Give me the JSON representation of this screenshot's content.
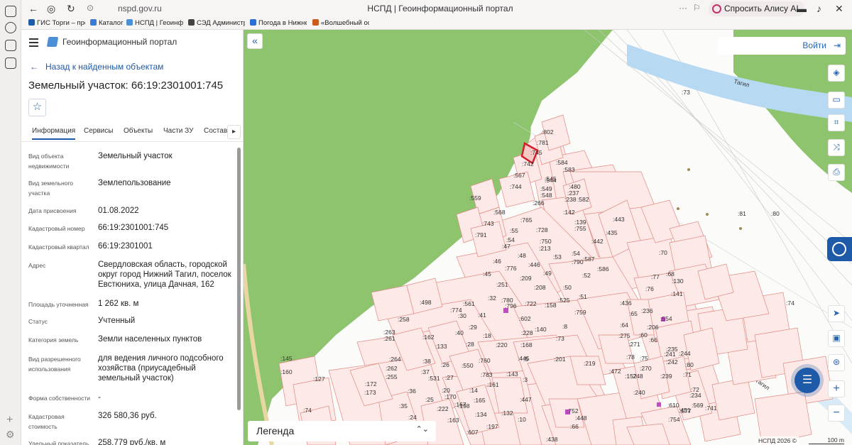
{
  "browser": {
    "url": "nspd.gov.ru",
    "page_title": "НСПД | Геоинформационный портал",
    "alice_label": "Спросить Алису AI"
  },
  "bookmarks": [
    {
      "label": "ГИС Торги – прод",
      "color": "#1d5aa8"
    },
    {
      "label": "Каталог",
      "color": "#3a7bd5"
    },
    {
      "label": "НСПД | Геоинфор",
      "color": "#4d8fd6"
    },
    {
      "label": "СЭД Администрат",
      "color": "#444444"
    },
    {
      "label": "Погода в Нижнем",
      "color": "#2c6ed3"
    },
    {
      "label": "«Волшебный ост",
      "color": "#cc5a1a"
    }
  ],
  "panel": {
    "portal_title": "Геоинформационный портал",
    "back_label": "Назад к найденным объектам",
    "parcel_title": "Земельный участок: 66:19:2301001:745",
    "tabs": [
      "Информация",
      "Сервисы",
      "Объекты",
      "Части ЗУ",
      "Состав"
    ],
    "fields": [
      {
        "label": "Вид объекта недвижимости",
        "value": "Земельный участок"
      },
      {
        "label": "Вид земельного участка",
        "value": "Землепользование"
      },
      {
        "label": "Дата присвоения",
        "value": "01.08.2022"
      },
      {
        "label": "Кадастровый номер",
        "value": "66:19:2301001:745"
      },
      {
        "label": "Кадастровый квартал",
        "value": "66:19:2301001"
      },
      {
        "label": "Адрес",
        "value": "Свердловская область, городской округ город Нижний Тагил, поселок Евстюниха, улица Дачная, 162"
      },
      {
        "label": "Площадь уточненная",
        "value": "1 262 кв. м"
      },
      {
        "label": "Статус",
        "value": "Учтенный"
      },
      {
        "label": "Категория земель",
        "value": "Земли населенных пунктов"
      },
      {
        "label": "Вид разрешенного использования",
        "value": "для ведения личного подсобного хозяйства (приусадебный земельный участок)"
      },
      {
        "label": "Форма собственности",
        "value": "-"
      },
      {
        "label": "Кадастровая стоимость",
        "value": "326 580,36 руб."
      },
      {
        "label": "Удельный показатель",
        "value": "258,779 руб./кв. м"
      }
    ]
  },
  "map": {
    "login_label": "Войти",
    "legend_label": "Легенда",
    "copyright": "НСПД 2026 ©",
    "scale_label": "100 m",
    "river_label": "Тагил",
    "selected_parcel": ":745",
    "parcel_labels": [
      ":802",
      ":781",
      ":745",
      ":742",
      ":584",
      ":583",
      ":567",
      ":744",
      ":549",
      ":545",
      ":544",
      ":548",
      ":480",
      ":237",
      ":238",
      ":582",
      ":559",
      ":568",
      ":266",
      ":142",
      ":443",
      ":743",
      ":791",
      ":765",
      ":728",
      ":139",
      ":755",
      ":435",
      ":55",
      ":54",
      ":750",
      ":442",
      ":54",
      ":47",
      ":48",
      ":213",
      ":53",
      ":587",
      ":586",
      ":46",
      ":776",
      ":446",
      ":790",
      ":52",
      ":45",
      ":209",
      ":49",
      ":251",
      ":208",
      ":50",
      ":51",
      ":32",
      ":722",
      ":525",
      ":759",
      ":498",
      ":561",
      ":774",
      ":780",
      ":158",
      ":41",
      ":30",
      ":796",
      ":602",
      ":140",
      ":258",
      ":29",
      ":228",
      ":8",
      ":263",
      ":261",
      ":162",
      ":40",
      ":18",
      ":168",
      ":73",
      ":133",
      ":28",
      ":220",
      ":445",
      ":264",
      ":38",
      ":550",
      ":760",
      ":5",
      ":201",
      ":262",
      ":37",
      ":26",
      ":783",
      ":143",
      ":255",
      ":531",
      ":27",
      ":161",
      ":3",
      ":172",
      ":36",
      ":20",
      ":14",
      ":173",
      ":170",
      ":165",
      ":35",
      ":25",
      ":167",
      ":24",
      ":198",
      ":447",
      ":222",
      ":134",
      ":132",
      ":163",
      ":197",
      ":10",
      ":607",
      ":145",
      ":160",
      ":127",
      ":74",
      ":73",
      ":81",
      ":80",
      ":74",
      ":70",
      ":77",
      ":68",
      ":76",
      ":130",
      ":141",
      ":436",
      ":236",
      ":554",
      ":65",
      ":64",
      ":206",
      ":60",
      ":275",
      ":66",
      ":271",
      ":75",
      ":78",
      ":241",
      ":235",
      ":244",
      ":219",
      ":270",
      ":242",
      ":80",
      ":152",
      ":472",
      ":248",
      ":239",
      ":71",
      ":72",
      ":240",
      ":234",
      ":451",
      ":610",
      ":577",
      ":754",
      ":569",
      ":752",
      ":448",
      ":66",
      ":741",
      ":438"
    ]
  }
}
